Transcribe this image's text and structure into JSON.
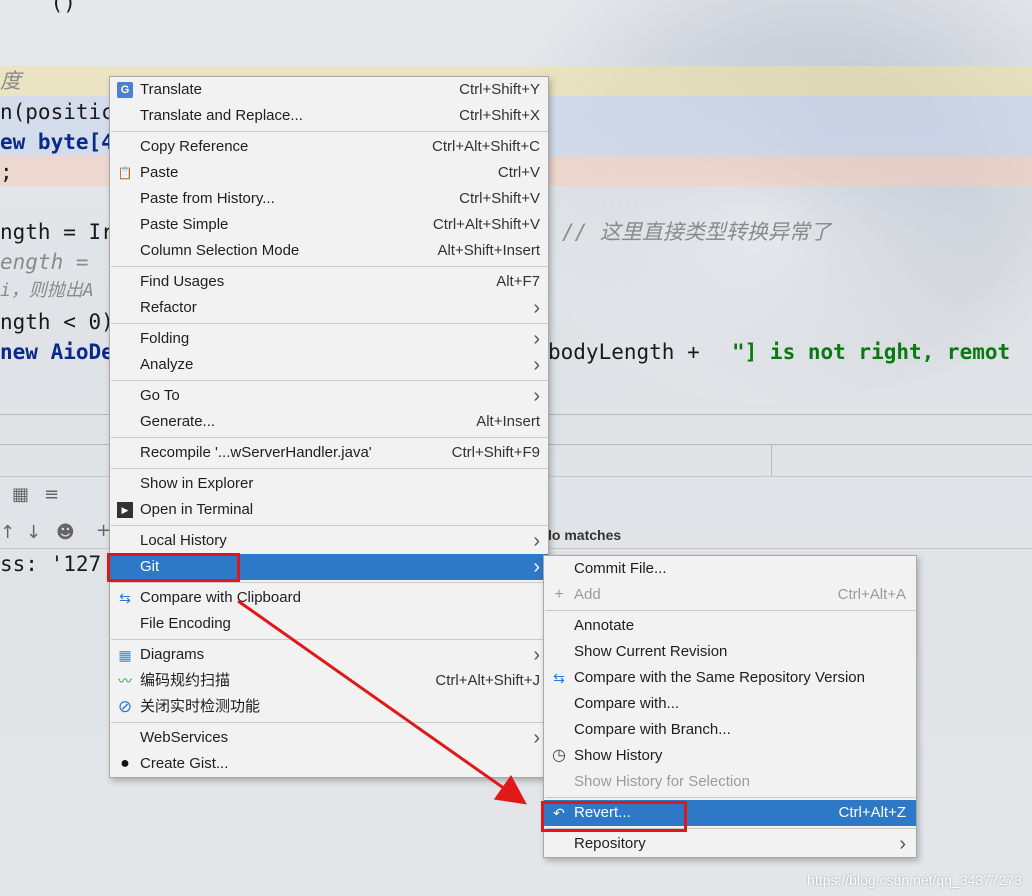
{
  "editor": {
    "lines": [
      {
        "text": "    ()",
        "cls": ""
      },
      {
        "text": "度",
        "cls": "code-comment"
      },
      {
        "text": "n(positic",
        "cls": ""
      },
      {
        "text": "ew byte[4",
        "cls": "code-kw"
      },
      {
        "text": ";",
        "cls": ""
      },
      {
        "text": "ngth = Ir",
        "cls": ""
      },
      {
        "text": "ength =",
        "cls": "code-comment"
      },
      {
        "text": "i，则抛出A",
        "cls": "code-comment"
      },
      {
        "text": "ngth < 0)",
        "cls": ""
      },
      {
        "text": "new AioDe",
        "cls": "code-kw"
      }
    ],
    "comment_right": "// 这里直接类型转换异常了",
    "string_right_prefix": "bodyLength + ",
    "string_right": "\"] is not right, remot",
    "no_matches": "lo matches",
    "console_text": "ss: '127"
  },
  "context_menu": {
    "groups": [
      [
        {
          "label": "Translate",
          "shortcut": "Ctrl+Shift+Y",
          "icon": "translate-icon",
          "glyph": "G"
        },
        {
          "label": "Translate and Replace...",
          "shortcut": "Ctrl+Shift+X"
        }
      ],
      [
        {
          "label": "Copy Reference",
          "shortcut": "Ctrl+Alt+Shift+C"
        },
        {
          "label": "Paste",
          "shortcut": "Ctrl+V",
          "icon": "clipboard-icon",
          "glyph": "📋"
        },
        {
          "label": "Paste from History...",
          "shortcut": "Ctrl+Shift+V"
        },
        {
          "label": "Paste Simple",
          "shortcut": "Ctrl+Alt+Shift+V"
        },
        {
          "label": "Column Selection Mode",
          "shortcut": "Alt+Shift+Insert"
        }
      ],
      [
        {
          "label": "Find Usages",
          "shortcut": "Alt+F7"
        },
        {
          "label": "Refactor",
          "submenu": true
        }
      ],
      [
        {
          "label": "Folding",
          "submenu": true
        },
        {
          "label": "Analyze",
          "submenu": true
        }
      ],
      [
        {
          "label": "Go To",
          "submenu": true
        },
        {
          "label": "Generate...",
          "shortcut": "Alt+Insert"
        }
      ],
      [
        {
          "label": "Recompile '...wServerHandler.java'",
          "shortcut": "Ctrl+Shift+F9"
        }
      ],
      [
        {
          "label": "Show in Explorer"
        },
        {
          "label": "Open in Terminal",
          "icon": "terminal-icon",
          "glyph": "▶"
        }
      ],
      [
        {
          "label": "Local History",
          "submenu": true
        },
        {
          "label": "Git",
          "submenu": true,
          "selected": true
        }
      ],
      [
        {
          "label": "Compare with Clipboard",
          "icon": "compare-icon",
          "glyph": "⇆"
        },
        {
          "label": "File Encoding"
        }
      ],
      [
        {
          "label": "Diagrams",
          "submenu": true,
          "icon": "diagram-icon",
          "glyph": "▦"
        },
        {
          "label": "编码规约扫描",
          "shortcut": "Ctrl+Alt+Shift+J",
          "icon": "scan-icon",
          "glyph": "〰"
        },
        {
          "label": "关闭实时检测功能",
          "icon": "disable-icon",
          "glyph": "⊘"
        }
      ],
      [
        {
          "label": "WebServices",
          "submenu": true
        },
        {
          "label": "Create Gist...",
          "icon": "github-icon",
          "glyph": "●"
        }
      ]
    ]
  },
  "git_submenu": {
    "groups": [
      [
        {
          "label": "Commit File..."
        },
        {
          "label": "Add",
          "shortcut": "Ctrl+Alt+A",
          "disabled": true,
          "icon": "add-icon",
          "glyph": "+"
        }
      ],
      [
        {
          "label": "Annotate"
        },
        {
          "label": "Show Current Revision"
        },
        {
          "label": "Compare with the Same Repository Version",
          "icon": "compare-icon",
          "glyph": "⇆"
        },
        {
          "label": "Compare with..."
        },
        {
          "label": "Compare with Branch..."
        },
        {
          "label": "Show History",
          "icon": "history-icon",
          "glyph": "◷"
        },
        {
          "label": "Show History for Selection",
          "disabled": true
        }
      ],
      [
        {
          "label": "Revert...",
          "shortcut": "Ctrl+Alt+Z",
          "selected": true,
          "icon": "revert-icon",
          "glyph": "↶"
        }
      ],
      [
        {
          "label": "Repository",
          "submenu": true
        }
      ]
    ]
  },
  "watermark": "https://blog.csdn.net/qq_34377273"
}
